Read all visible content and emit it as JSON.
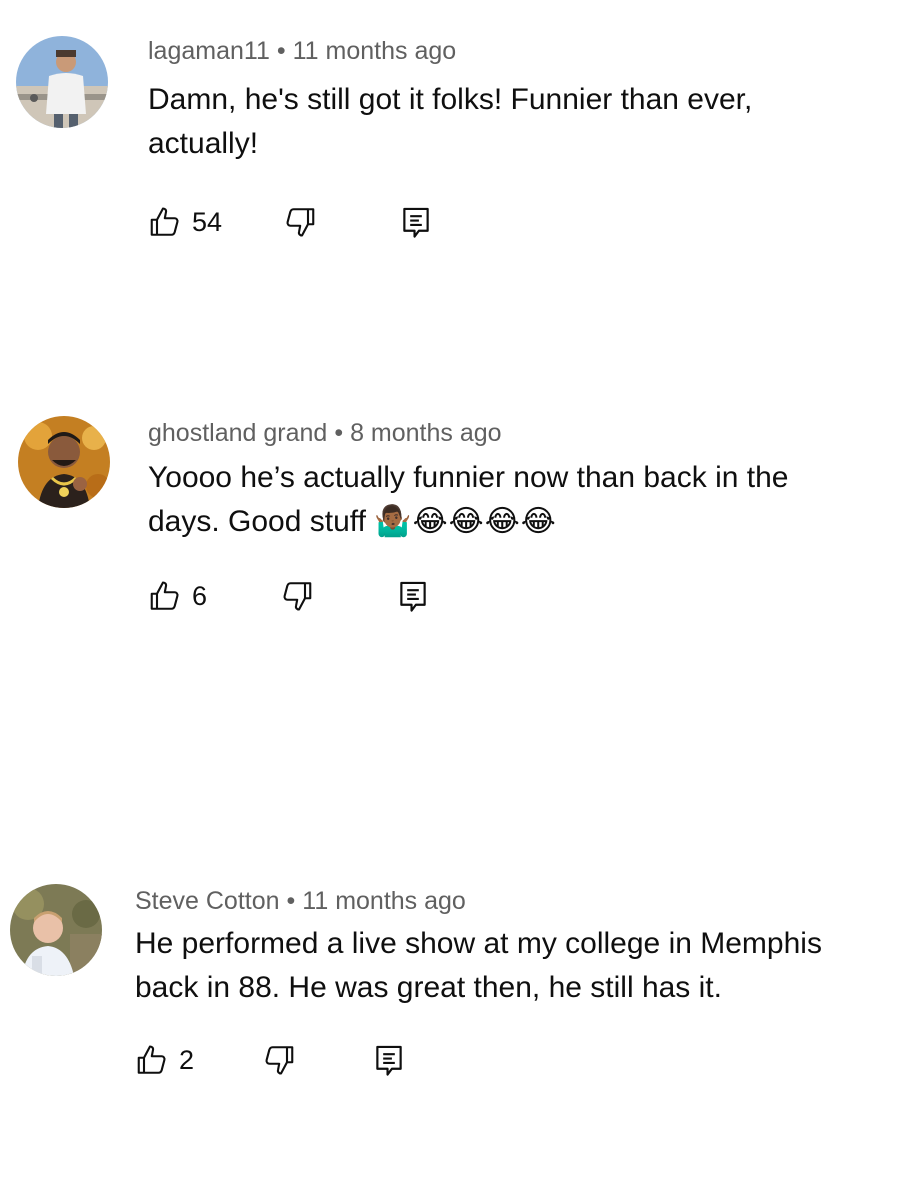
{
  "comments": [
    {
      "author": "lagaman11",
      "separator": "•",
      "time": "11 months ago",
      "text": "Damn, he's still got it folks! Funnier than ever, actually!",
      "emojis": "",
      "likes": "54",
      "avatar_icon": "user-avatar-man-white-shirt",
      "avatar_colors": [
        "#7fa7d4",
        "#d8cfc4"
      ]
    },
    {
      "author": "ghostland grand",
      "separator": "•",
      "time": "8 months ago",
      "text": "Yoooo he’s actually funnier now than back in the days. Good stuff",
      "emojis": "🤷🏾‍♂️😂😂😂😂",
      "likes": "6",
      "avatar_icon": "user-avatar-man-gold-chain",
      "avatar_colors": [
        "#c9791d",
        "#3a2a22"
      ]
    },
    {
      "author": "Steve Cotton",
      "separator": "•",
      "time": "11 months ago",
      "text": "He performed a live show at my college in Memphis back in 88. He was great then, he still has it.",
      "emojis": "",
      "likes": "2",
      "avatar_icon": "user-avatar-man-outdoors",
      "avatar_colors": [
        "#7c7a55",
        "#e9eef5"
      ]
    }
  ],
  "icons": {
    "like": "thumbs-up-icon",
    "dislike": "thumbs-down-icon",
    "reply": "reply-comment-icon"
  }
}
